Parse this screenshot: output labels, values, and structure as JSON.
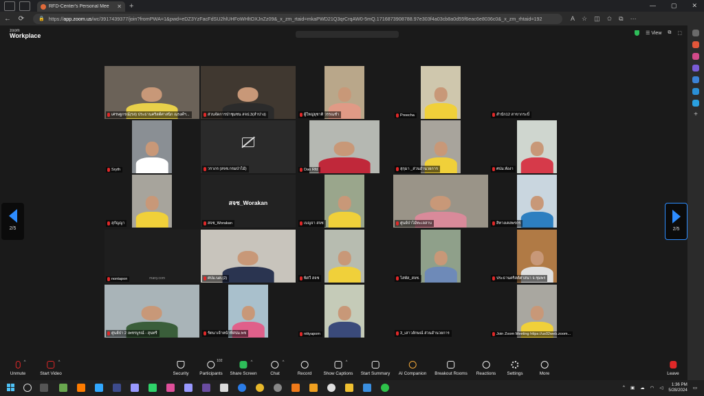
{
  "browser": {
    "tab_title": "RFD-Center's Personal Mee",
    "url_prefix": "https://",
    "url_host": "app.zoom.us",
    "url_rest": "/wc/3917439377/join?fromPWA=1&pwd=eDZ3YzFacFdSU2hlUHFoWHltOXJnZz09&_x_zm_rtaid=mkaPWD21Q3qrCrqAW0-5mQ.1716873908788.97e303f4a03cb8a0d55f6eac6e8036c0&_x_zm_rhtaid=192"
  },
  "zoom": {
    "logo_small": "zoom",
    "logo_big": "Workplace",
    "view_label": "View"
  },
  "tiles": [
    {
      "name": "เศรษฐกรณ์(รส) ประธานคริสต์ศาสนิก ณรงค์ฯ...",
      "bg": "#6b6258",
      "shirt": "#e8d04a",
      "type": "full"
    },
    {
      "name": "ส่วนจัดการป่าชุมชน สจป.3(ลำปาง)",
      "bg": "#403830",
      "shirt": "#2b2b2b",
      "type": "full"
    },
    {
      "name": "ผู้ใหญ่ยุชาติ วรรณชำ",
      "bg": "#b9a78a",
      "shirt": "#e09a86",
      "type": "narrow"
    },
    {
      "name": "Preecha",
      "bg": "#cfc7ad",
      "shirt": "#f0d03a",
      "type": "narrow"
    },
    {
      "name": "สำนัก12 สาขากระบี่",
      "bg": "",
      "shirt": "",
      "type": "empty"
    },
    {
      "name": "Sryth",
      "bg": "#8a8f94",
      "shirt": "#ffffff",
      "type": "narrow"
    },
    {
      "name": "วราภร (สจช.กรมป่าไม้)",
      "bg": "#2a2a2a",
      "shirt": "",
      "type": "camoff"
    },
    {
      "name": "Dao Rfd",
      "bg": "#b5b8b2",
      "shirt": "#c0283a",
      "type": "wide"
    },
    {
      "name": "สุกุมา _ส่วนอำนวยการ",
      "bg": "#a8a49c",
      "shirt": "#f0d03a",
      "type": "narrow"
    },
    {
      "name": "ศปม.พังงา",
      "bg": "#cfd6cf",
      "shirt": "#d63a4a",
      "type": "narrow"
    },
    {
      "name": "สุกัญญา",
      "bg": "#a7a49c",
      "shirt": "#f0d03a",
      "type": "narrow"
    },
    {
      "name": "สจช_Worakan",
      "bg": "#222222",
      "shirt": "",
      "type": "text",
      "display": "สจช_Worakan"
    },
    {
      "name": "เบญจา สจช",
      "bg": "#9aa68c",
      "shirt": "#f0d03a",
      "type": "narrow"
    },
    {
      "name": "ศูนย์ป่าไม้ทะเลสาบ",
      "bg": "#9a9488",
      "shirt": "#d98a9a",
      "type": "full"
    },
    {
      "name": "สิทางเคลพรกร",
      "bg": "#c9d6df",
      "shirt": "#2d7fc0",
      "type": "narrow"
    },
    {
      "name": "nontapon",
      "bg": "#1e1e1e",
      "shirt": "",
      "type": "dark",
      "watermark": "many.com"
    },
    {
      "name": "ศปม.นค.(2)",
      "bg": "#c8c4bc",
      "shirt": "#2a3450",
      "type": "full"
    },
    {
      "name": "พิสวี สจช",
      "bg": "#b7bcb0",
      "shirt": "#f0d03a",
      "type": "narrow"
    },
    {
      "name": "ไสพัส_สจช.",
      "bg": "#8fa08a",
      "shirt": "#6e8ab8",
      "type": "narrow"
    },
    {
      "name": "ประธานคริสต์ศาสนา จ.ชุมพร",
      "bg": "#b07a45",
      "shirt": "#e0e0e0",
      "type": "narrow"
    },
    {
      "name": "ศูนย์ป่า 2 เพชรบูรณ์ - สุนทรี",
      "bg": "#a9b4b8",
      "shirt": "#3a5e3a",
      "type": "full"
    },
    {
      "name": "รัตนาเจ้าหน้าที่ศปม.พช",
      "bg": "#a9c0cc",
      "shirt": "#e0608a",
      "type": "narrow"
    },
    {
      "name": "nitiyapom",
      "bg": "#c5cbb8",
      "shirt": "#3a4a7a",
      "type": "narrow"
    },
    {
      "name": "3_เสาวลักษณ์ ส่วนอำนวยการ",
      "bg": "",
      "shirt": "",
      "type": "empty"
    },
    {
      "name": "Join Zoom Meeting https://us02web.zoom...",
      "bg": "#a9a7a0",
      "shirt": "#f0d03a",
      "type": "narrow"
    }
  ],
  "pager": {
    "left": "2/5",
    "right": "2/5"
  },
  "toolbar": {
    "unmute": "Unmute",
    "start_video": "Start Video",
    "security": "Security",
    "participants": "Participants",
    "participants_count": "102",
    "share_screen": "Share Screen",
    "chat": "Chat",
    "record": "Record",
    "show_captions": "Show Captions",
    "start_summary": "Start Summary",
    "ai_companion": "AI Companion",
    "breakout_rooms": "Breakout Rooms",
    "reactions": "Reactions",
    "settings": "Settings",
    "more": "More",
    "leave": "Leave"
  },
  "taskbar": {
    "time": "1:36 PM",
    "date": "5/28/2024"
  }
}
